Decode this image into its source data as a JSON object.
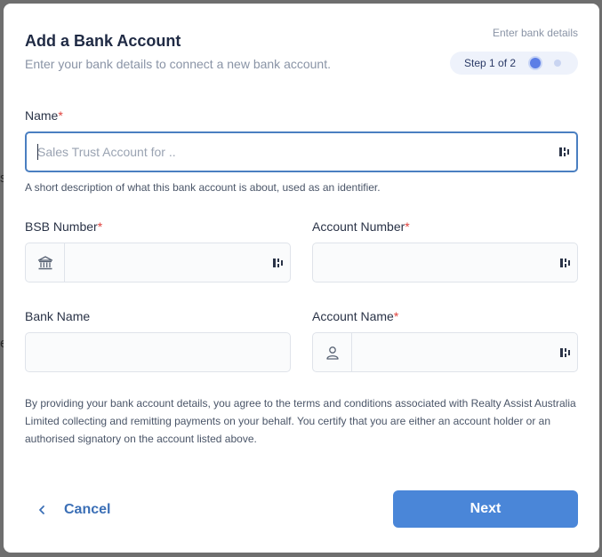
{
  "header": {
    "title": "Add a Bank Account",
    "subtitle": "Enter your bank details to connect a new bank account."
  },
  "stepper": {
    "caption": "Enter bank details",
    "step_text": "Step 1 of 2",
    "current_step": 1,
    "total_steps": 2
  },
  "form": {
    "name": {
      "label": "Name",
      "required_mark": "*",
      "value": "",
      "placeholder": "Sales Trust Account for ..",
      "helper": "A short description of what this bank account is about, used as an identifier."
    },
    "bsb": {
      "label": "BSB Number",
      "required_mark": "*",
      "value": "",
      "placeholder": ""
    },
    "account_number": {
      "label": "Account Number",
      "required_mark": "*",
      "value": "",
      "placeholder": ""
    },
    "bank_name": {
      "label": "Bank Name",
      "value": "",
      "placeholder": ""
    },
    "account_name": {
      "label": "Account Name",
      "required_mark": "*",
      "value": "",
      "placeholder": ""
    }
  },
  "terms": "By providing your bank account details, you agree to the terms and conditions associated with Realty Assist Australia Limited collecting and remitting payments on your behalf. You certify that you are either an account holder or an authorised signatory on the account listed above.",
  "actions": {
    "cancel_label": "Cancel",
    "next_label": "Next"
  },
  "colors": {
    "accent": "#4a86d8",
    "link": "#3b6fb6",
    "required": "#e0413c",
    "focus_border": "#4a7fc1"
  },
  "icons": {
    "bsb_prefix": "bank-icon",
    "account_name_prefix": "user-icon",
    "input_suffix": "password-manager-icon",
    "cancel": "chevron-left-icon"
  }
}
